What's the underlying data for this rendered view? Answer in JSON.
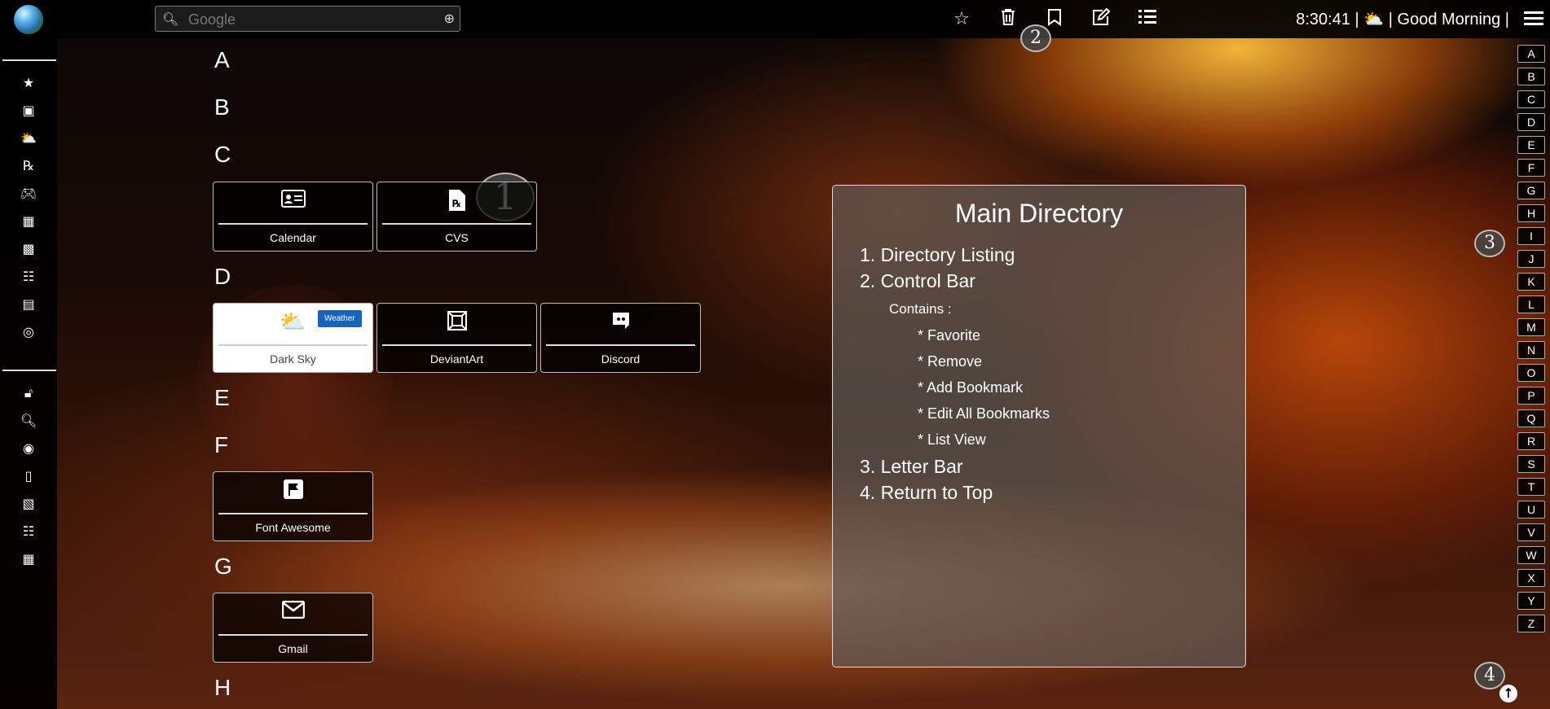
{
  "topbar": {
    "search_placeholder": "Google",
    "icons": [
      "star-icon",
      "trash-icon",
      "bookmark-icon",
      "edit-icon",
      "list-icon"
    ],
    "time": "8:30:41",
    "greeting": "| ⛅ | Good Morning |"
  },
  "badges": {
    "b1": "1",
    "b2": "2",
    "b3": "3",
    "b4": "4"
  },
  "sidebar": {
    "group1": [
      "star-icon",
      "art-frame-icon",
      "weather-icon",
      "prescription-icon",
      "gamepad-icon",
      "images-icon",
      "building-icon",
      "network-icon",
      "id-card-icon",
      "globe-icon"
    ],
    "group2": [
      "unlock-icon",
      "search-icon",
      "spotify-icon",
      "file-icon",
      "calendar-icon",
      "network-icon",
      "images-icon"
    ]
  },
  "sections": [
    {
      "letter": "A"
    },
    {
      "letter": "B"
    },
    {
      "letter": "C",
      "cards": [
        {
          "label": "Calendar",
          "icon": "id-card-icon"
        },
        {
          "label": "CVS",
          "icon": "prescription-icon"
        }
      ]
    },
    {
      "letter": "D",
      "cards": [
        {
          "label": "Dark Sky",
          "icon": "weather-icon",
          "badge": "Weather"
        },
        {
          "label": "DeviantArt",
          "icon": "art-frame-icon"
        },
        {
          "label": "Discord",
          "icon": "discord-icon"
        }
      ]
    },
    {
      "letter": "E"
    },
    {
      "letter": "F",
      "cards": [
        {
          "label": "Font Awesome",
          "icon": "flag-icon"
        }
      ]
    },
    {
      "letter": "G",
      "cards": [
        {
          "label": "Gmail",
          "icon": "envelope-icon"
        }
      ]
    },
    {
      "letter": "H"
    }
  ],
  "panel": {
    "title": "Main Directory",
    "lines": [
      "1. Directory Listing",
      "2. Control Bar",
      "Contains :",
      "* Favorite",
      "* Remove",
      "* Add Bookmark",
      "* Edit All Bookmarks",
      "* List View",
      "3. Letter Bar",
      "4. Return to Top"
    ]
  },
  "letterbar": [
    "A",
    "B",
    "C",
    "D",
    "E",
    "F",
    "G",
    "H",
    "I",
    "J",
    "K",
    "L",
    "M",
    "N",
    "O",
    "P",
    "Q",
    "R",
    "S",
    "T",
    "U",
    "V",
    "W",
    "X",
    "Y",
    "Z"
  ],
  "return_to_top_icon": "arrow-up-circle-icon"
}
